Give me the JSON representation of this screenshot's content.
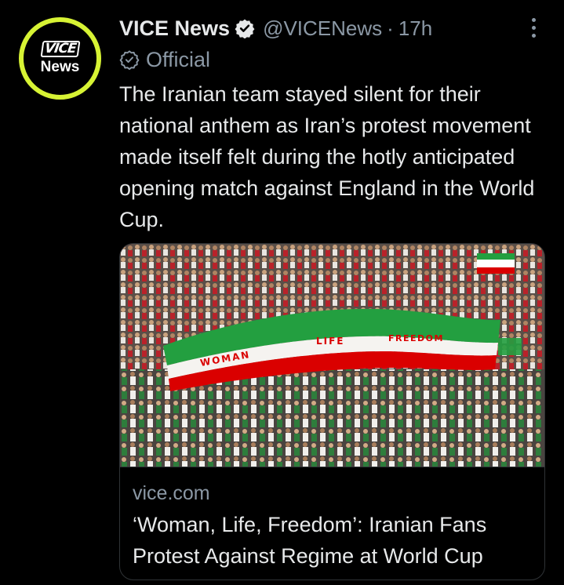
{
  "tweet": {
    "display_name": "VICE News",
    "handle": "@VICENews",
    "separator": "·",
    "time": "17h",
    "label": "Official",
    "text": "The Iranian team stayed silent for their national anthem as Iran’s protest movement made itself felt during the hotly anticipated opening match against England in the World Cup."
  },
  "avatar": {
    "logo_text": "VICE",
    "sub_text": "News",
    "ring_color": "#d7f334"
  },
  "card": {
    "domain": "vice.com",
    "title": "‘Woman, Life, Freedom’: Iranian Fans Protest Against Regime at World Cup",
    "banner_words": [
      "WOMAN",
      "LIFE",
      "FREEDOM"
    ]
  },
  "colors": {
    "background": "#000000",
    "text": "#e7e9ea",
    "secondary": "#8b98a5",
    "border": "#2f3336",
    "flag_green": "#239f40",
    "flag_red": "#da0000"
  },
  "icons": {
    "verified": "verified-badge-icon",
    "label": "official-label-icon",
    "more": "more-options-icon"
  }
}
